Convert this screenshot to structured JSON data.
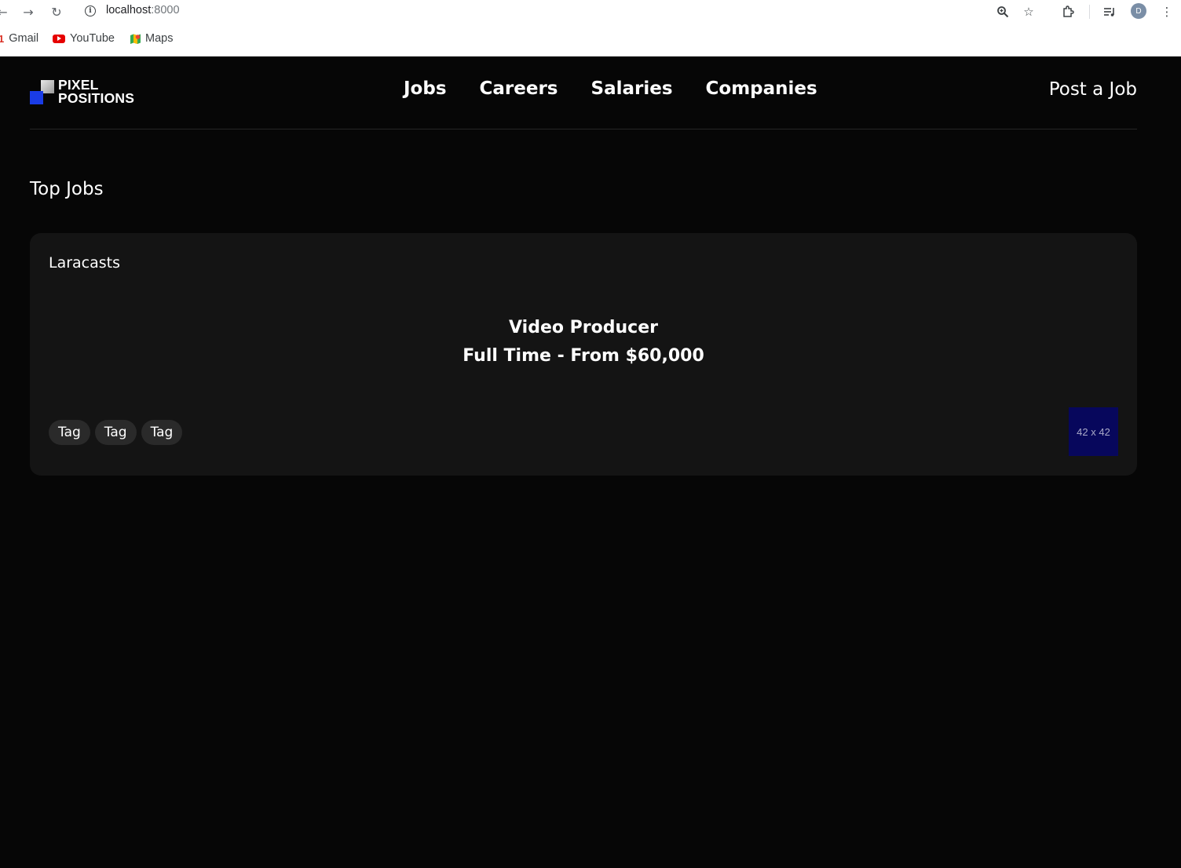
{
  "browser": {
    "url_host": "localhost",
    "url_port": ":8000",
    "profile_initial": "D",
    "bookmarks": [
      {
        "label": "Gmail",
        "icon": "gmail-icon"
      },
      {
        "label": "YouTube",
        "icon": "youtube-icon"
      },
      {
        "label": "Maps",
        "icon": "maps-icon"
      }
    ]
  },
  "site": {
    "logo_line1": "PIXEL",
    "logo_line2": "POSITIONS",
    "nav": [
      "Jobs",
      "Careers",
      "Salaries",
      "Companies"
    ],
    "post_job": "Post a Job"
  },
  "main": {
    "section_title": "Top Jobs",
    "job": {
      "company": "Laracasts",
      "title": "Video Producer",
      "meta": "Full Time - From $60,000",
      "tags": [
        "Tag",
        "Tag",
        "Tag"
      ],
      "logo_placeholder": "42 x 42"
    }
  },
  "colors": {
    "page_bg": "#060606",
    "card_bg": "#141414",
    "tag_bg": "#2a2a2a",
    "brand_blue": "#1a3ce6",
    "logo_placeholder_bg": "#07075c"
  }
}
